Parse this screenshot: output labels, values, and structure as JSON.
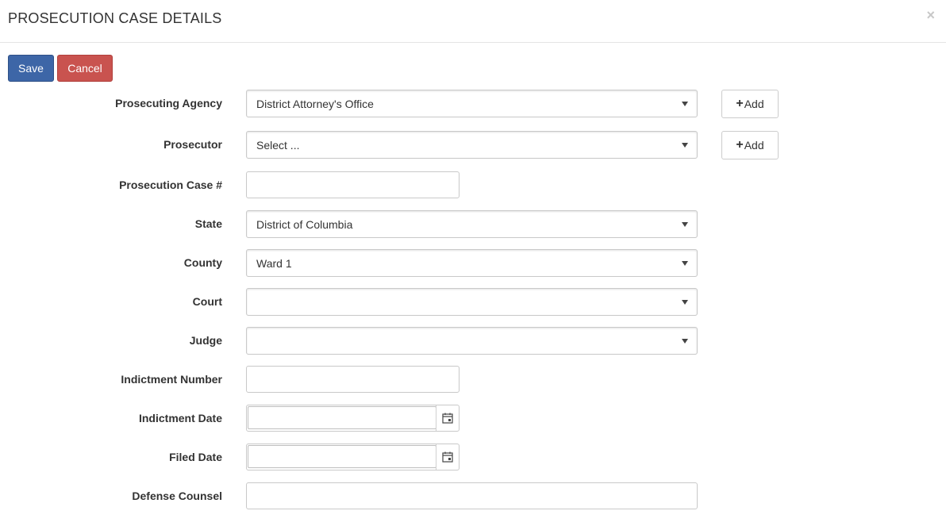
{
  "dialog": {
    "title": "PROSECUTION CASE DETAILS",
    "close_symbol": "×"
  },
  "toolbar": {
    "save_label": "Save",
    "cancel_label": "Cancel"
  },
  "form": {
    "prosecuting_agency": {
      "label": "Prosecuting Agency",
      "value": "District Attorney's Office"
    },
    "prosecutor": {
      "label": "Prosecutor",
      "value": "Select ..."
    },
    "prosecution_case_number": {
      "label": "Prosecution Case #",
      "value": ""
    },
    "state": {
      "label": "State",
      "value": "District of Columbia"
    },
    "county": {
      "label": "County",
      "value": "Ward 1"
    },
    "court": {
      "label": "Court",
      "value": ""
    },
    "judge": {
      "label": "Judge",
      "value": ""
    },
    "indictment_number": {
      "label": "Indictment Number",
      "value": ""
    },
    "indictment_date": {
      "label": "Indictment Date",
      "value": ""
    },
    "filed_date": {
      "label": "Filed Date",
      "value": ""
    },
    "defense_counsel": {
      "label": "Defense Counsel",
      "value": ""
    }
  },
  "add_button": {
    "plus": "+",
    "label": "Add"
  },
  "icons": {
    "close": "close-icon",
    "dropdown": "chevron-down-icon",
    "calendar": "calendar-icon",
    "plus": "plus-icon"
  },
  "colors": {
    "save": "#3d66a7",
    "cancel": "#c9534f"
  }
}
